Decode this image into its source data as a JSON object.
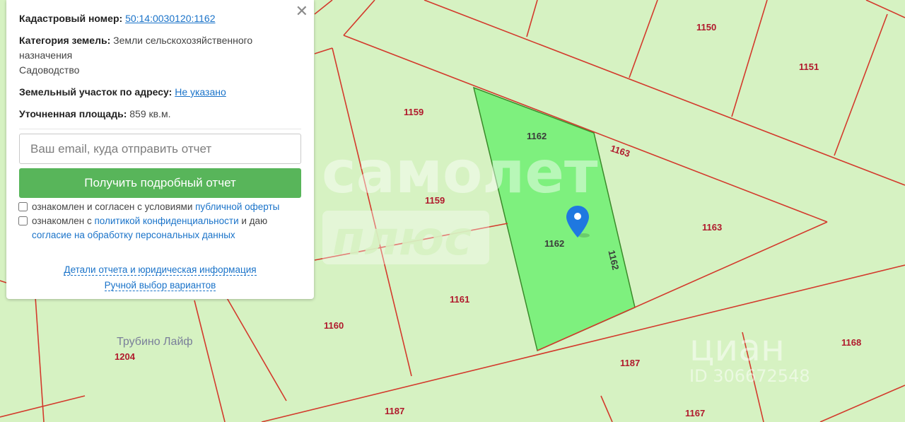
{
  "panel": {
    "close_label": "✕",
    "cadastral_label": "Кадастровый номер:",
    "cadastral_value": "50:14:0030120:1162",
    "category_label": "Категория земель:",
    "category_value": "Земли сельскохозяйственного назначения",
    "usage_value": "Садоводство",
    "address_label": "Земельный участок по адресу:",
    "address_value": "Не указано",
    "area_label": "Уточненная площадь:",
    "area_value": "859 кв.м.",
    "email_placeholder": "Ваш email, куда отправить отчет",
    "submit_label": "Получить подробный отчет",
    "consent1_text": "ознакомлен и согласен с условиями ",
    "consent1_link": "публичной оферты",
    "consent2_text": "ознакомлен с ",
    "consent2_link": "политикой конфиденциальности",
    "consent2_text2": " и даю ",
    "consent2_link2": "согласие на обработку персональных данных",
    "details_link": "Детали отчета и юридическая информация",
    "manual_link": "Ручной выбор вариантов"
  },
  "map": {
    "plot_labels": [
      "1150",
      "1151",
      "1159",
      "1159",
      "1162",
      "1162",
      "1162",
      "1163",
      "1163",
      "1161",
      "1160",
      "1204",
      "1187",
      "1187",
      "1168",
      "1167"
    ],
    "place_label": "Трубино Лайф",
    "watermark_main": "самолет",
    "watermark_sub": "плюс",
    "watermark_cian": "циан",
    "watermark_id": "ID 306672548",
    "selected_plot_color": "#7ef07e",
    "boundary_color": "#d33a2c",
    "marker_color": "#1f78e0"
  }
}
